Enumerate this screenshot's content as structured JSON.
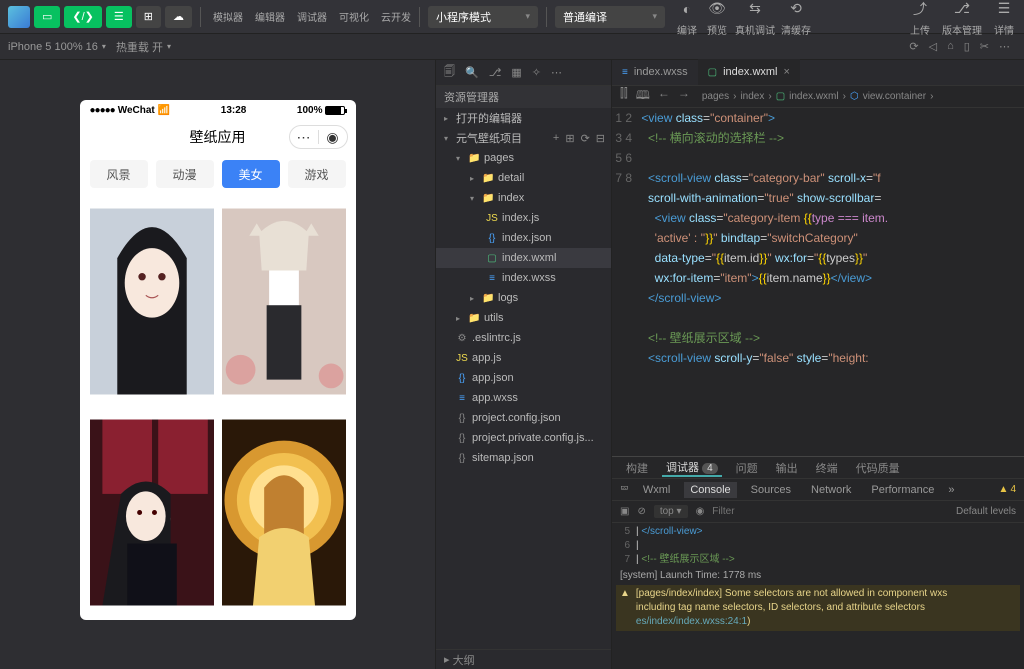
{
  "toolbar": {
    "group1": [
      "模拟器",
      "编辑器",
      "调试器",
      "可视化",
      "云开发"
    ],
    "mode_select": "小程序模式",
    "compile_select": "普通编译",
    "actions": [
      "编译",
      "预览",
      "真机调试",
      "清缓存"
    ],
    "right": [
      "上传",
      "版本管理",
      "详情"
    ]
  },
  "row2": {
    "device": "iPhone 5 100% 16",
    "hot": "热重载 开"
  },
  "simulator": {
    "wechat": "WeChat",
    "signal_icon": "●●●●●",
    "wifi_icon": "⋏",
    "time": "13:28",
    "battery": "100%",
    "title": "壁纸应用",
    "categories": [
      "风景",
      "动漫",
      "美女",
      "游戏"
    ],
    "active_cat": 2
  },
  "explorer": {
    "title": "资源管理器",
    "open_editors": "打开的编辑器",
    "project": "元气壁纸项目",
    "tree": {
      "pages": "pages",
      "detail": "detail",
      "index": "index",
      "index_js": "index.js",
      "index_json": "index.json",
      "index_wxml": "index.wxml",
      "index_wxss": "index.wxss",
      "logs": "logs",
      "utils": "utils",
      "eslintrc": ".eslintrc.js",
      "app_js": "app.js",
      "app_json": "app.json",
      "app_wxss": "app.wxss",
      "proj_cfg": "project.config.json",
      "proj_priv": "project.private.config.js...",
      "sitemap": "sitemap.json"
    },
    "outline": "大纲"
  },
  "tabs": {
    "t1": "index.wxss",
    "t2": "index.wxml"
  },
  "breadcrumb": [
    "pages",
    "index",
    "index.wxml",
    "view.container"
  ],
  "code": {
    "l1": "<view class=\"container\">",
    "l2": "<!-- 横向滚动的选择栏 -->",
    "l3a": "<scroll-view class=\"category-bar\" scroll-x=\"f",
    "l3b": "scroll-with-animation=\"true\" show-scrollbar=",
    "l4a": "<view class=\"category-item {{type === item.",
    "l4b": "'active' : ''}}\" bindtap=\"switchCategory\"",
    "l4c": "data-type=\"{{item.id}}\" wx:for=\"{{types}}\"",
    "l4d": "wx:for-item=\"item\">{{item.name}}</view>",
    "l5": "</scroll-view>",
    "l7": "<!-- 壁纸展示区域 -->",
    "l8": "<scroll-view scroll-y=\"false\" style=\"height:"
  },
  "bottom": {
    "tabs": [
      "构建",
      "调试器",
      "问题",
      "输出",
      "终端",
      "代码质量"
    ],
    "active": 1,
    "badge": "4",
    "devtabs": [
      "Wxml",
      "Console",
      "Sources",
      "Network",
      "Performance"
    ],
    "dev_active": 1,
    "warn_count": "4",
    "top": "top",
    "filter_ph": "Filter",
    "levels": "Default levels",
    "console": {
      "l5n": "5",
      "l5": "</scroll-view>",
      "l6n": "6",
      "l6": "",
      "l7n": "7",
      "l7": "<!-- 壁纸展示区域 -->",
      "sys": "[system] Launch Time: 1778 ms",
      "warn1": "[pages/index/index] Some selectors are not allowed in component wxs",
      "warn2": "including tag name selectors, ID selectors, and attribute selectors",
      "warn_link": "es/index/index.wxss:24:1",
      "warn_paren": ")"
    }
  }
}
